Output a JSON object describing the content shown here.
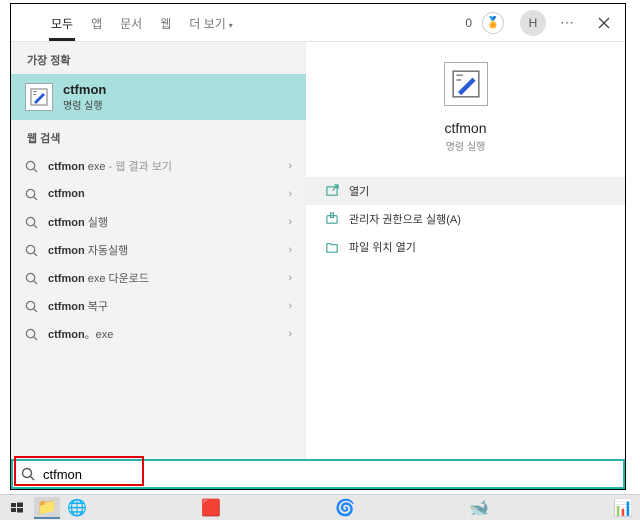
{
  "header": {
    "tabs": [
      "모두",
      "앱",
      "문서",
      "웹",
      "더 보기"
    ],
    "active_index": 0,
    "points": "0",
    "avatar": "H"
  },
  "left": {
    "best_label": "가장 정확",
    "best": {
      "title": "ctfmon",
      "subtitle": "명령 실행"
    },
    "web_label": "웹 검색",
    "rows": [
      {
        "bold": "ctfmon",
        "plain": " exe",
        "hint": " - 웹 결과 보기"
      },
      {
        "bold": "ctfmon",
        "plain": "",
        "hint": ""
      },
      {
        "bold": "ctfmon",
        "plain": " 실행",
        "hint": ""
      },
      {
        "bold": "ctfmon",
        "plain": " 자동실행",
        "hint": ""
      },
      {
        "bold": "ctfmon",
        "plain": " exe 다운로드",
        "hint": ""
      },
      {
        "bold": "ctfmon",
        "plain": " 복구",
        "hint": ""
      },
      {
        "bold": "ctfmon",
        "plain": "。exe",
        "hint": ""
      }
    ]
  },
  "right": {
    "title": "ctfmon",
    "subtitle": "명령 실행",
    "actions": [
      {
        "label": "열기",
        "icon": "open"
      },
      {
        "label": "관리자 권한으로 실행(A)",
        "icon": "admin"
      },
      {
        "label": "파일 위치 열기",
        "icon": "folder"
      }
    ],
    "selected_action": 0
  },
  "search": {
    "value": "ctfmon"
  }
}
